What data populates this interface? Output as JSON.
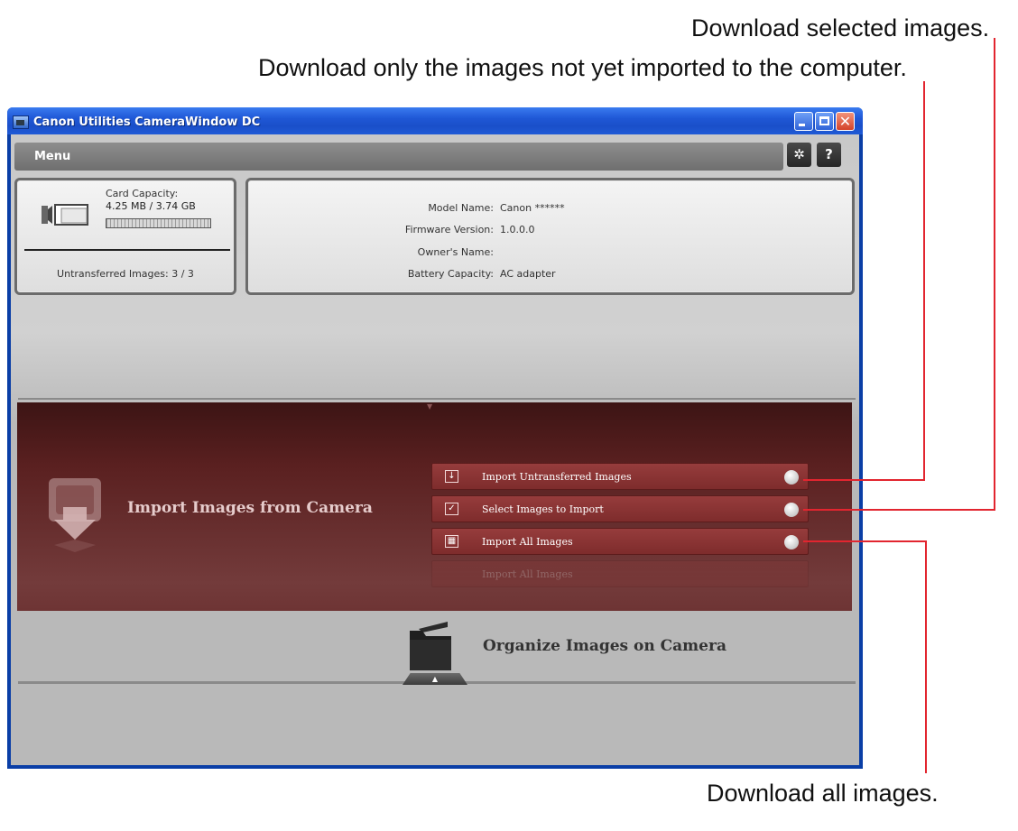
{
  "callouts": {
    "download_selected": "Download selected images.",
    "download_not_imported": "Download only the images not yet imported to the computer.",
    "download_all": "Download all images."
  },
  "window": {
    "title": "Canon Utilities CameraWindow DC",
    "close_glyph": "✕"
  },
  "menu": {
    "label": "Menu",
    "settings_icon": "gear-icon",
    "settings_glyph": "✲",
    "help_glyph": "?"
  },
  "card": {
    "capacity_label": "Card Capacity:",
    "capacity_value": "4.25 MB / 3.74 GB",
    "untransferred": "Untransferred Images: 3 / 3"
  },
  "camera_info": {
    "model_label": "Model Name:",
    "model_value": "Canon ******",
    "firmware_label": "Firmware Version:",
    "firmware_value": "1.0.0.0",
    "owner_label": "Owner's Name:",
    "owner_value": "",
    "battery_label": "Battery Capacity:",
    "battery_value": "AC adapter"
  },
  "import_section": {
    "title": "Import Images from Camera",
    "options": [
      {
        "label": "Import Untransferred Images",
        "icon": "import-untransferred-icon",
        "glyph": "↓"
      },
      {
        "label": "Select Images to Import",
        "icon": "checkbox-icon",
        "glyph": "✓"
      },
      {
        "label": "Import All Images",
        "icon": "grid-icon",
        "glyph": "▦"
      }
    ],
    "ghost_option": "Import All Images"
  },
  "organize_section": {
    "title": "Organize Images on Camera",
    "expand_glyph": "▲"
  },
  "colors": {
    "callout_line": "#e2252f",
    "import_bg": "#5a2020",
    "option_bg": "#963c3c",
    "titlebar": "#1f58d6"
  }
}
